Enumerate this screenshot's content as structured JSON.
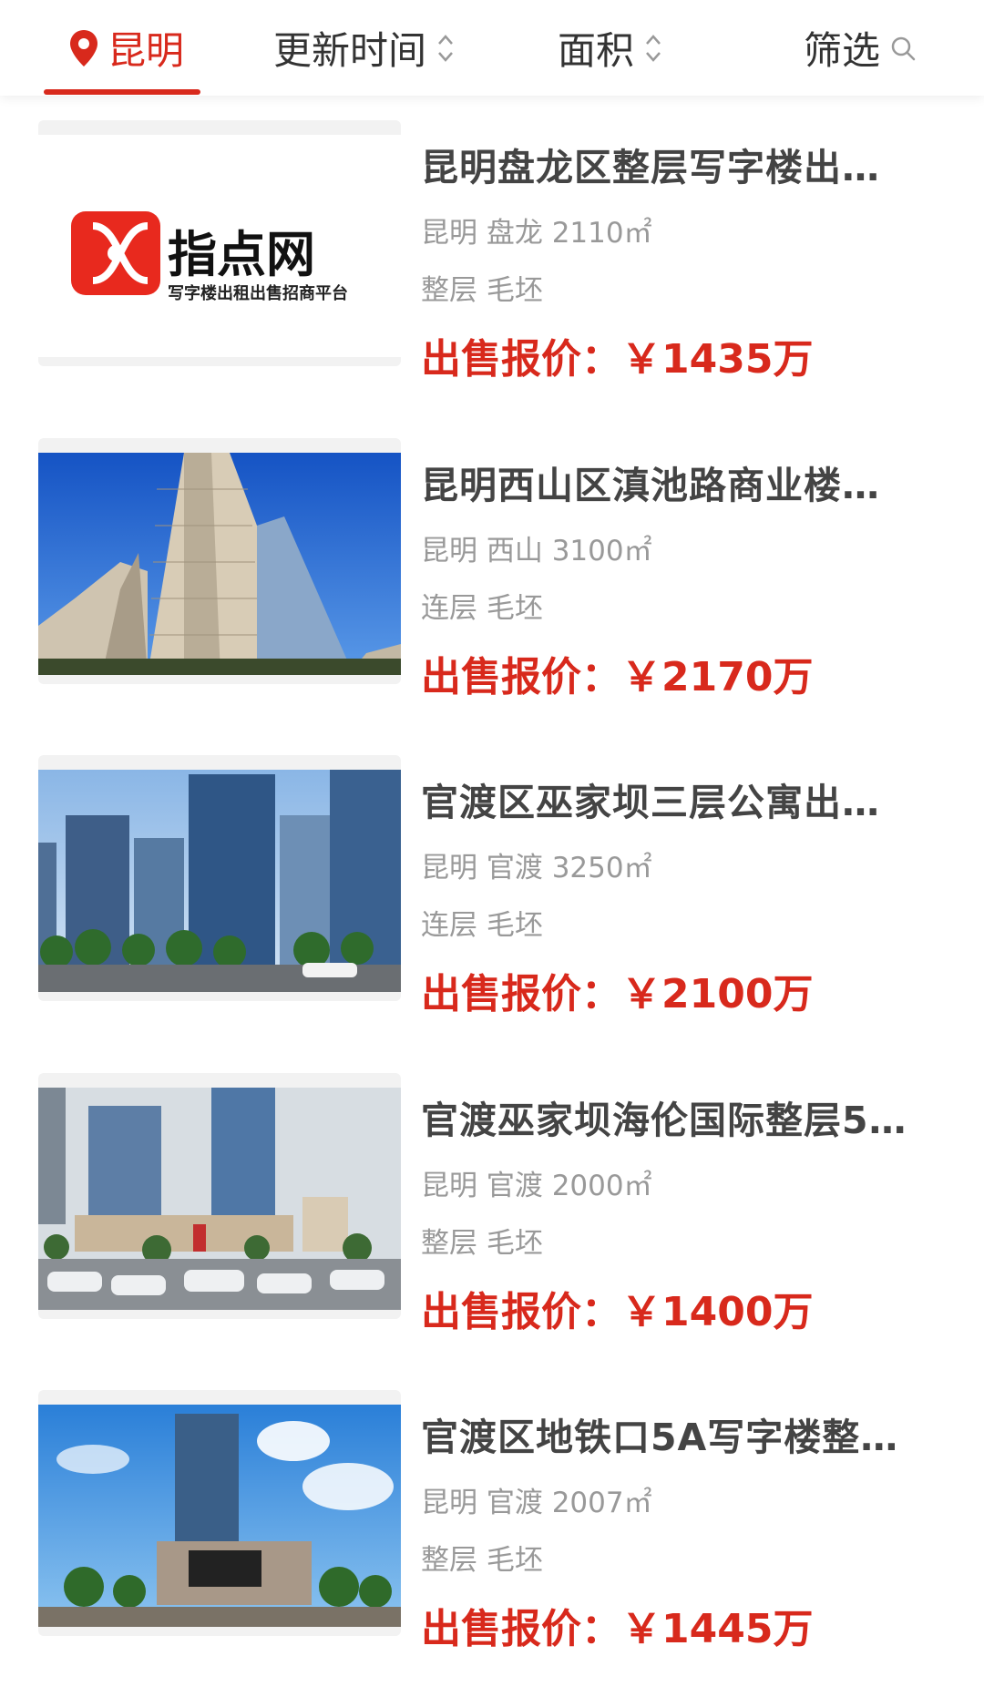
{
  "filter_bar": {
    "city": "昆明",
    "update_time": "更新时间",
    "area": "面积",
    "filter": "筛选",
    "accent_color": "#d8291c"
  },
  "listings": [
    {
      "title": "昆明盘龙区整层写字楼出…",
      "meta": "昆明 盘龙 2110㎡",
      "tags": "整层 毛坯",
      "price": "出售报价：￥1435万",
      "image": {
        "type": "logo",
        "brand": "指点网",
        "tagline": "写字楼出租出售招商平台"
      }
    },
    {
      "title": "昆明西山区滇池路商业楼…",
      "meta": "昆明 西山 3100㎡",
      "tags": "连层 毛坯",
      "price": "出售报价：￥2170万",
      "image": {
        "type": "photo",
        "subject": "high-rise tower under blue sky"
      }
    },
    {
      "title": "官渡区巫家坝三层公寓出…",
      "meta": "昆明 官渡 3250㎡",
      "tags": "连层 毛坯",
      "price": "出售报价：￥2100万",
      "image": {
        "type": "photo",
        "subject": "city skyline with glass towers"
      }
    },
    {
      "title": "官渡巫家坝海伦国际整层5…",
      "meta": "昆明 官渡 2000㎡",
      "tags": "整层 毛坯",
      "price": "出售报价：￥1400万",
      "image": {
        "type": "photo",
        "subject": "twin towers with parking lot"
      }
    },
    {
      "title": "官渡区地铁口5A写字楼整…",
      "meta": "昆明 官渡 2007㎡",
      "tags": "整层 毛坯",
      "price": "出售报价：￥1445万",
      "image": {
        "type": "photo",
        "subject": "tower above IMAX mall"
      }
    }
  ]
}
